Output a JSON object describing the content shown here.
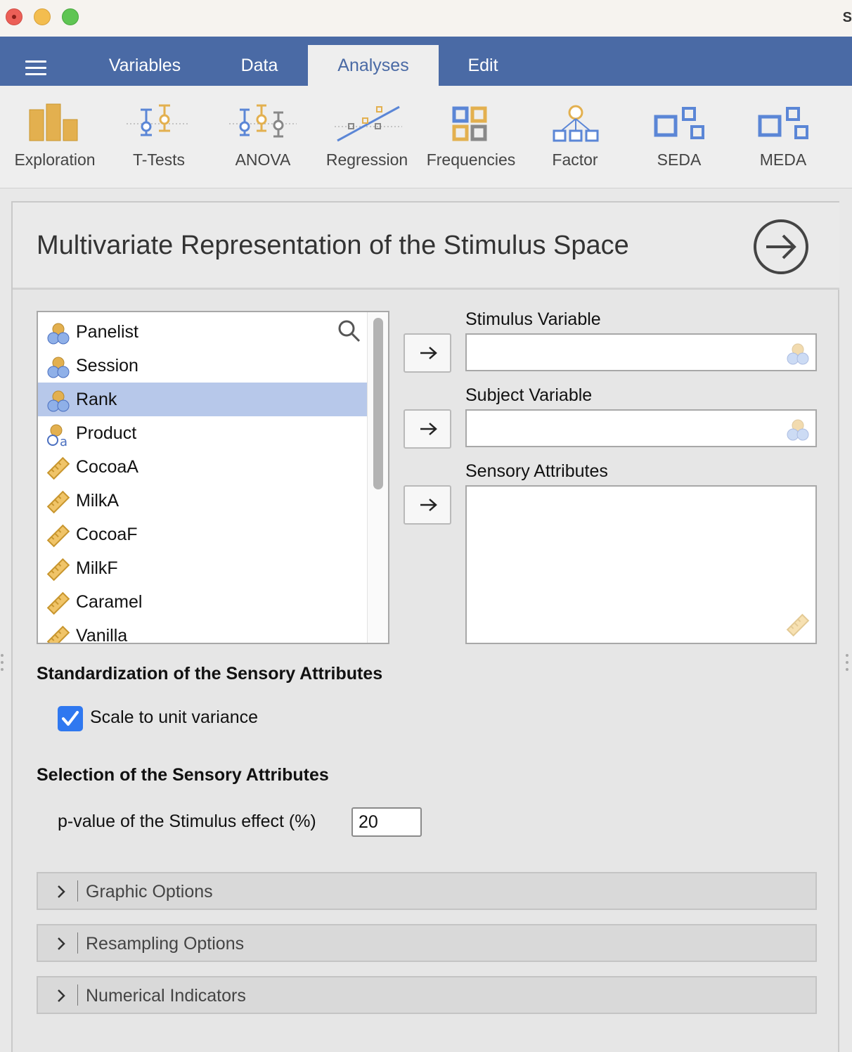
{
  "window": {
    "title_visible": "S"
  },
  "nav": {
    "tabs": [
      {
        "label": "Variables"
      },
      {
        "label": "Data"
      },
      {
        "label": "Analyses",
        "active": true
      },
      {
        "label": "Edit"
      }
    ]
  },
  "ribbon": {
    "items": [
      {
        "label": "Exploration",
        "icon": "exploration-icon"
      },
      {
        "label": "T-Tests",
        "icon": "ttests-icon"
      },
      {
        "label": "ANOVA",
        "icon": "anova-icon"
      },
      {
        "label": "Regression",
        "icon": "regression-icon"
      },
      {
        "label": "Frequencies",
        "icon": "frequencies-icon"
      },
      {
        "label": "Factor",
        "icon": "factor-icon"
      },
      {
        "label": "SEDA",
        "icon": "seda-icon"
      },
      {
        "label": "MEDA",
        "icon": "meda-icon"
      }
    ]
  },
  "panel": {
    "title": "Multivariate Representation of the Stimulus Space",
    "variables": [
      {
        "label": "Panelist",
        "type": "nominal"
      },
      {
        "label": "Session",
        "type": "nominal"
      },
      {
        "label": "Rank",
        "type": "nominal",
        "selected": true
      },
      {
        "label": "Product",
        "type": "nominal-text"
      },
      {
        "label": "CocoaA",
        "type": "continuous"
      },
      {
        "label": "MilkA",
        "type": "continuous"
      },
      {
        "label": "CocoaF",
        "type": "continuous"
      },
      {
        "label": "MilkF",
        "type": "continuous"
      },
      {
        "label": "Caramel",
        "type": "continuous"
      },
      {
        "label": "Vanilla",
        "type": "continuous"
      }
    ],
    "targets": {
      "stimulus_label": "Stimulus Variable",
      "subject_label": "Subject Variable",
      "sensory_label": "Sensory Attributes"
    },
    "standardization": {
      "heading": "Standardization of the Sensory Attributes",
      "checkbox_label": "Scale to unit variance",
      "checked": true
    },
    "selection": {
      "heading": "Selection of the Sensory Attributes",
      "pvalue_label": "p-value of the Stimulus effect (%)",
      "pvalue": "20"
    },
    "collapsibles": [
      {
        "label": "Graphic Options"
      },
      {
        "label": "Resampling Options"
      },
      {
        "label": "Numerical Indicators"
      }
    ]
  },
  "colors": {
    "nav_bg": "#4a6aa5",
    "accent_orange": "#e3b04f",
    "accent_blue": "#5b86d6",
    "selected_row": "#b7c8ea",
    "checkbox": "#2f78f0"
  }
}
